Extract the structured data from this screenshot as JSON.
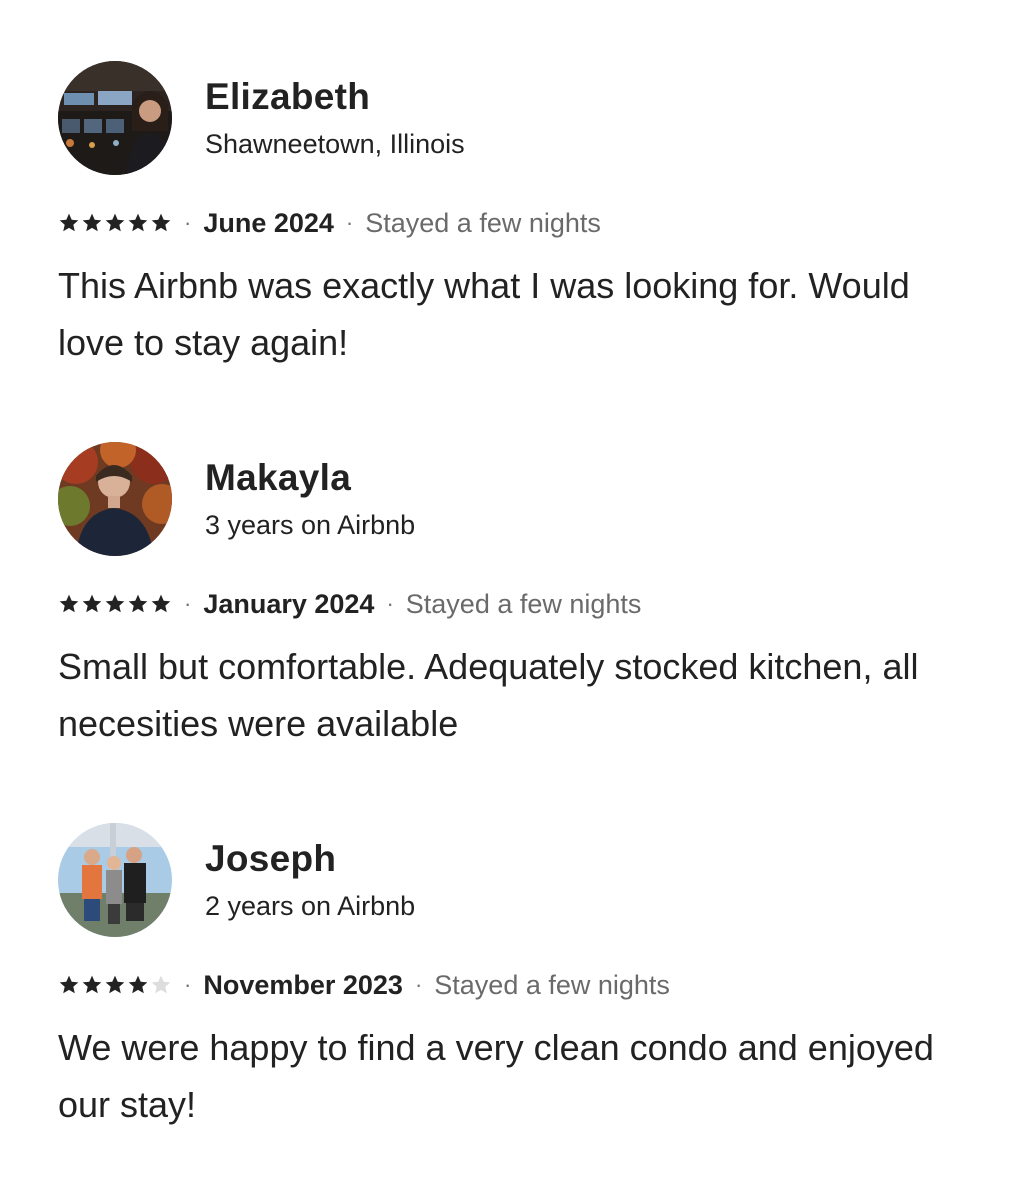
{
  "reviews": [
    {
      "name": "Elizabeth",
      "subtitle": "Shawneetown, Illinois",
      "rating": 5,
      "date": "June 2024",
      "stay": "Stayed a few nights",
      "text": "This Airbnb was exactly what I was looking for. Would love to stay again!",
      "separator": "·"
    },
    {
      "name": "Makayla",
      "subtitle": "3 years on Airbnb",
      "rating": 5,
      "date": "January 2024",
      "stay": "Stayed a few nights",
      "text": "Small but comfortable. Adequately stocked kitchen, all necesities were available",
      "separator": "·"
    },
    {
      "name": "Joseph",
      "subtitle": "2 years on Airbnb",
      "rating": 4,
      "date": "November 2023",
      "stay": "Stayed a few nights",
      "text": "We were happy to find a very clean condo and enjoyed our stay!",
      "separator": "·"
    }
  ],
  "icons": {
    "star": "star-icon"
  },
  "colors": {
    "text": "#222222",
    "muted": "#6a6a6a",
    "star_filled": "#222222",
    "star_empty": "#dddddd"
  }
}
